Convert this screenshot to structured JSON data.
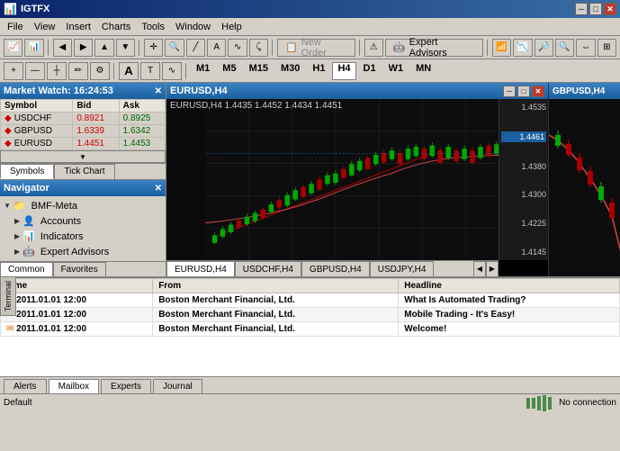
{
  "app": {
    "title": "IGTFX"
  },
  "titlebar": {
    "title": "IGTFX",
    "minimize": "─",
    "maximize": "□",
    "close": "✕"
  },
  "menu": {
    "items": [
      "File",
      "View",
      "Insert",
      "Charts",
      "Tools",
      "Window",
      "Help"
    ]
  },
  "toolbar": {
    "new_order": "New Order",
    "expert_advisors": "Expert Advisors",
    "timeframes": [
      "M1",
      "M5",
      "M15",
      "M30",
      "H1",
      "H4",
      "D1",
      "W1",
      "MN"
    ],
    "active_timeframe": "H4"
  },
  "market_watch": {
    "title": "Market Watch: 16:24:53",
    "headers": [
      "Symbol",
      "Bid",
      "Ask"
    ],
    "rows": [
      {
        "symbol": "USDCHF",
        "bid": "0.8921",
        "ask": "0.8925"
      },
      {
        "symbol": "GBPUSD",
        "bid": "1.6339",
        "ask": "1.6342"
      },
      {
        "symbol": "EURUSD",
        "bid": "1.4451",
        "ask": "1.4453"
      }
    ],
    "tabs": [
      "Symbols",
      "Tick Chart"
    ]
  },
  "navigator": {
    "title": "Navigator",
    "items": [
      {
        "label": "BMF-Meta",
        "type": "folder",
        "indent": 0
      },
      {
        "label": "Accounts",
        "type": "folder",
        "indent": 1
      },
      {
        "label": "Indicators",
        "type": "folder",
        "indent": 1
      },
      {
        "label": "Expert Advisors",
        "type": "folder",
        "indent": 1
      }
    ],
    "tabs": [
      "Common",
      "Favorites"
    ]
  },
  "chart_main": {
    "title": "EURUSD,H4",
    "info": "EURUSD,H4  1.4435  1.4452  1.4434  1.4451",
    "price_labels": [
      "1.4535",
      "1.4461",
      "1.4380",
      "1.4300",
      "1.4225",
      "1.4145"
    ],
    "current_price": "1.4461",
    "tabs": [
      "EURUSD,H4",
      "USDCHF,H4",
      "GBPUSD,H4",
      "USDJPY,H4"
    ]
  },
  "chart_side": {
    "title": "GBPUSD,H4"
  },
  "terminal": {
    "side_label": "Terminal",
    "headers": [
      "Time",
      "From",
      "Headline"
    ],
    "rows": [
      {
        "time": "2011.01.01 12:00",
        "from": "Boston Merchant Financial, Ltd.",
        "headline": "What Is Automated Trading?"
      },
      {
        "time": "2011.01.01 12:00",
        "from": "Boston Merchant Financial, Ltd.",
        "headline": "Mobile Trading - It's Easy!"
      },
      {
        "time": "2011.01.01 12:00",
        "from": "Boston Merchant Financial, Ltd.",
        "headline": "Welcome!"
      }
    ],
    "tabs": [
      "Alerts",
      "Mailbox",
      "Experts",
      "Journal"
    ],
    "active_tab": "Mailbox"
  },
  "status_bar": {
    "left": "Default",
    "right": "No connection"
  }
}
